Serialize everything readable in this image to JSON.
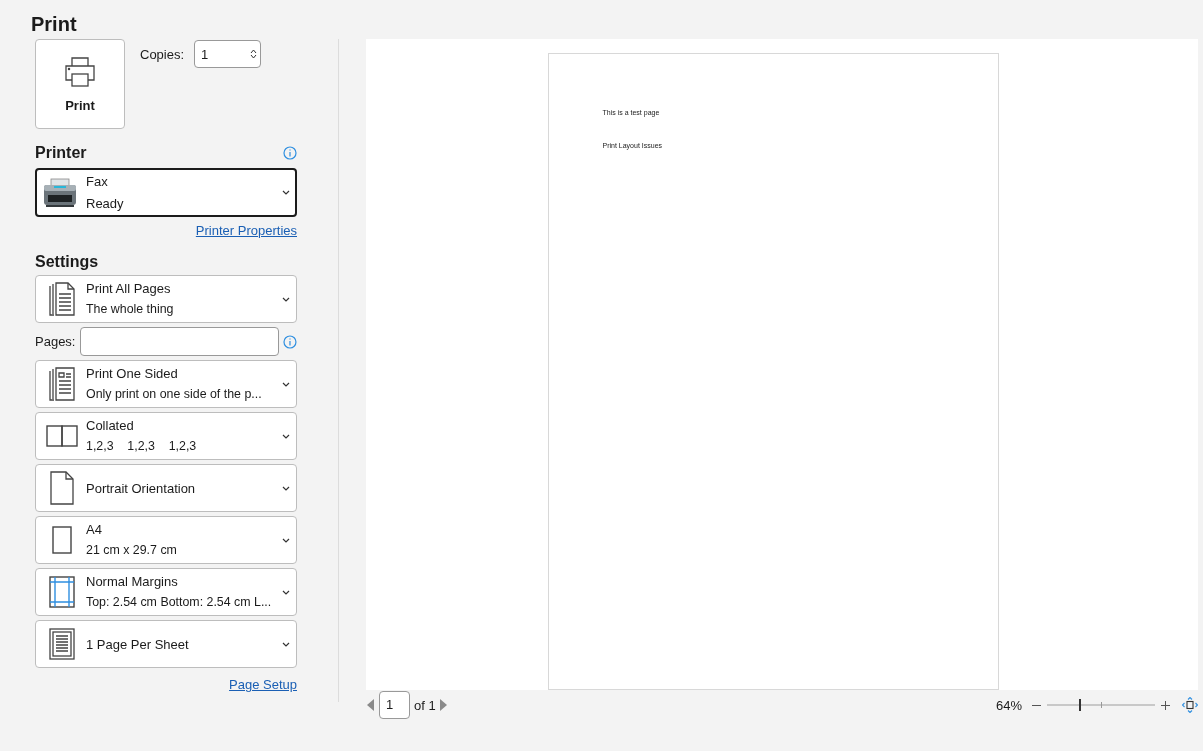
{
  "title": "Print",
  "print_button": "Print",
  "copies": {
    "label": "Copies:",
    "value": "1"
  },
  "printer": {
    "heading": "Printer",
    "name": "Fax",
    "status": "Ready",
    "properties_link": "Printer Properties"
  },
  "settings": {
    "heading": "Settings",
    "items": [
      {
        "kind": "dropdown",
        "title": "Print All Pages",
        "subtitle": "The whole thing"
      },
      {
        "kind": "field",
        "label": "Pages:"
      },
      {
        "kind": "dropdown",
        "title": "Print One Sided",
        "subtitle": "Only print on one side of the p..."
      },
      {
        "kind": "dropdown",
        "title": "Collated",
        "subtitle": "1,2,3    1,2,3    1,2,3"
      },
      {
        "kind": "dropdown",
        "title": "Portrait Orientation"
      },
      {
        "kind": "dropdown",
        "title": "A4",
        "subtitle": "21 cm x 29.7 cm"
      },
      {
        "kind": "dropdown",
        "title": "Normal Margins",
        "subtitle": "Top: 2.54 cm Bottom: 2.54 cm L..."
      },
      {
        "kind": "dropdown",
        "title": "1 Page Per Sheet"
      }
    ],
    "page_setup_link": "Page Setup"
  },
  "preview": {
    "lines": [
      "This is a test page",
      "Print Layout Issues"
    ]
  },
  "pager": {
    "page": "1",
    "total": "of 1"
  },
  "zoom": {
    "reading": "64%",
    "level": 0.31
  }
}
